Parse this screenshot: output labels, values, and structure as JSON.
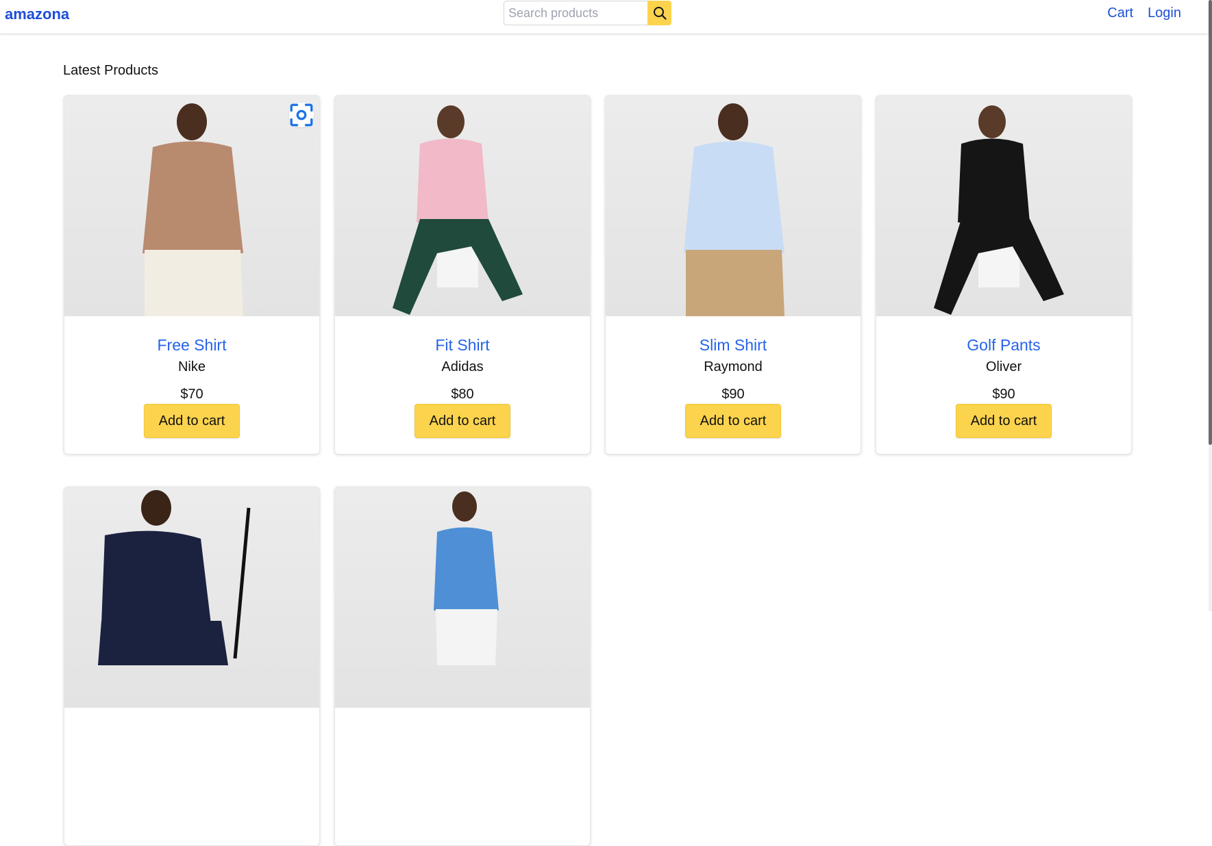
{
  "header": {
    "brand": "amazona",
    "search_placeholder": "Search products",
    "search_value": "",
    "nav": [
      "Cart",
      "Login"
    ]
  },
  "main": {
    "section_title": "Latest Products",
    "add_to_cart_label": "Add to cart",
    "products": [
      {
        "name": "Free Shirt",
        "brand": "Nike",
        "price": "$70",
        "shirt": "plaid-red",
        "pants": "cream",
        "pose": "standing"
      },
      {
        "name": "Fit Shirt",
        "brand": "Adidas",
        "price": "$80",
        "shirt": "pink",
        "pants": "dark-green",
        "pose": "seated"
      },
      {
        "name": "Slim Shirt",
        "brand": "Raymond",
        "price": "$90",
        "shirt": "light-blue",
        "pants": "tan",
        "pose": "standing"
      },
      {
        "name": "Golf Pants",
        "brand": "Oliver",
        "price": "$90",
        "shirt": "black",
        "pants": "black",
        "pose": "seated"
      },
      {
        "name": "",
        "brand": "",
        "price": "",
        "shirt": "navy-polo",
        "pants": "navy",
        "pose": "golf"
      },
      {
        "name": "",
        "brand": "",
        "price": "",
        "shirt": "blue-tee",
        "pants": "white",
        "pose": "walking"
      }
    ],
    "image_overlay_icon": "lens-scan-icon"
  },
  "colors": {
    "brand_blue": "#1d4ed8",
    "link_blue": "#2563eb",
    "button_yellow": "#fcd34d"
  }
}
